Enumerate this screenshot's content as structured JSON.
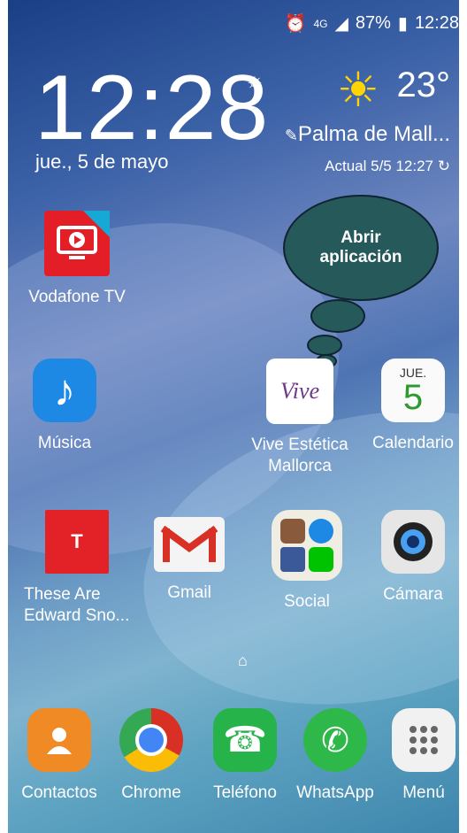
{
  "status": {
    "battery": "87%",
    "time": "12:28",
    "network": "4G"
  },
  "clock": {
    "time": "12:28",
    "date": "jue., 5 de mayo"
  },
  "weather": {
    "temp": "23°",
    "location": "Palma de Mall...",
    "updated": "Actual 5/5 12:27"
  },
  "bubble": {
    "text": "Abrir aplicación"
  },
  "apps": {
    "vodafone": "Vodafone TV",
    "musica": "Música",
    "vive": "Vive Estética Mallorca",
    "calendario": "Calendario",
    "cal_day": "JUE.",
    "cal_num": "5",
    "these": "These Are Edward Sno...",
    "gmail": "Gmail",
    "social": "Social",
    "camara": "Cámara",
    "vive_logo_text": "Vive",
    "these_letter": "T"
  },
  "dock": {
    "contactos": "Contactos",
    "chrome": "Chrome",
    "telefono": "Teléfono",
    "whatsapp": "WhatsApp",
    "menu": "Menú"
  }
}
